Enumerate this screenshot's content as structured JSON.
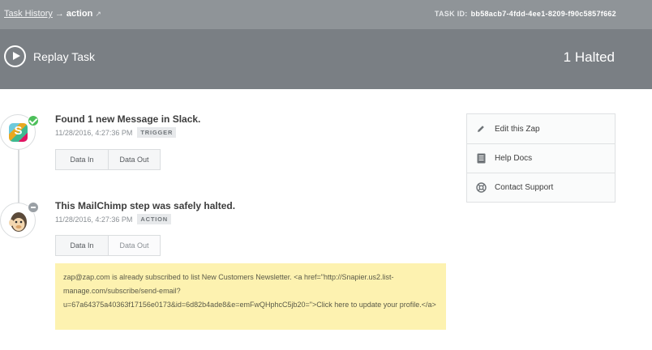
{
  "header": {
    "breadcrumb_link": "Task History",
    "breadcrumb_arrow": "→",
    "breadcrumb_current": "action",
    "task_id_label": "TASK ID:",
    "task_id_value": "bb58acb7-4fdd-4ee1-8209-f90c5857f662"
  },
  "actionbar": {
    "replay_label": "Replay Task",
    "status": "1 Halted"
  },
  "steps": [
    {
      "app_icon": "slack-icon",
      "status_icon": "success-check-icon",
      "title": "Found 1 new Message in Slack.",
      "timestamp": "11/28/2016, 4:27:36 PM",
      "tag": "TRIGGER",
      "tabs": [
        "Data In",
        "Data Out"
      ]
    },
    {
      "app_icon": "mailchimp-icon",
      "status_icon": "halted-icon",
      "title": "This MailChimp step was safely halted.",
      "timestamp": "11/28/2016, 4:27:36 PM",
      "tag": "ACTION",
      "tabs": [
        "Data In",
        "Data Out"
      ],
      "message": "zap@zap.com is already subscribed to list New Customers Newsletter. <a href=\"http://Snapier.us2.list-manage.com/subscribe/send-email?u=67a64375a40363f17156e0173&id=6d82b4ade8&e=emFwQHphcC5jb20=\">Click here to update your profile.</a>"
    }
  ],
  "sidebar": {
    "items": [
      {
        "label": "Edit this Zap",
        "icon": "pencil-icon"
      },
      {
        "label": "Help Docs",
        "icon": "document-icon"
      },
      {
        "label": "Contact Support",
        "icon": "lifebuoy-icon"
      }
    ]
  },
  "colors": {
    "topbar": "#8f9498",
    "actionbar": "#7a7f84",
    "success": "#4cbf5a",
    "halted": "#9aa0a5",
    "note_bg": "#fdf2b0"
  }
}
